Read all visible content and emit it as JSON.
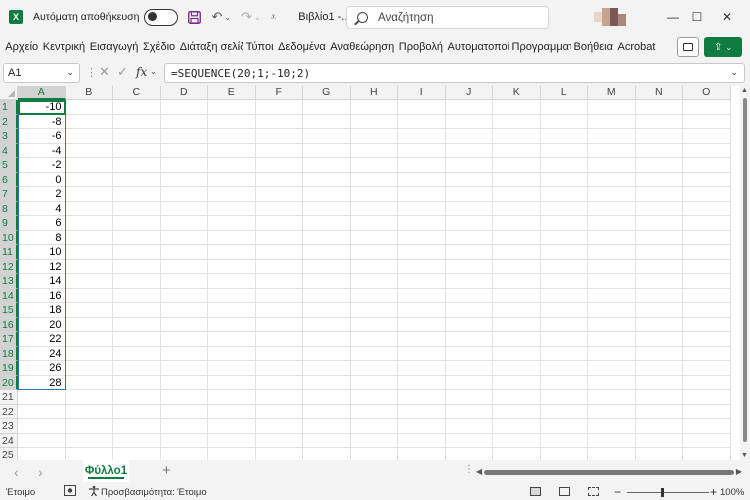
{
  "titlebar": {
    "logo_letter": "X",
    "autosave_label": "Αυτόματη αποθήκευση",
    "doc_title": "Βιβλίο1  -...",
    "search_placeholder": "Αναζήτηση",
    "minimize": "—",
    "maximize": "☐",
    "close": "✕"
  },
  "ribbon": {
    "tabs": [
      "Αρχείο",
      "Κεντρική",
      "Εισαγωγή",
      "Σχέδιο",
      "Διάταξη σελίδ",
      "Τύποι",
      "Δεδομένα",
      "Αναθεώρηση",
      "Προβολή",
      "Αυτοματοποί",
      "Προγραμματ",
      "Βοήθεια",
      "Acrobat"
    ]
  },
  "formula_bar": {
    "name_box": "A1",
    "formula": "=SEQUENCE(20;1;-10;2)"
  },
  "grid": {
    "columns": [
      "A",
      "B",
      "C",
      "D",
      "E",
      "F",
      "G",
      "H",
      "I",
      "J",
      "K",
      "L",
      "M",
      "N",
      "O"
    ],
    "rows": [
      "1",
      "2",
      "3",
      "4",
      "5",
      "6",
      "7",
      "8",
      "9",
      "10",
      "11",
      "12",
      "13",
      "14",
      "15",
      "16",
      "17",
      "18",
      "19",
      "20",
      "21",
      "22",
      "23",
      "24",
      "25"
    ],
    "column_a_values": [
      "-10",
      "-8",
      "-6",
      "-4",
      "-2",
      "0",
      "2",
      "4",
      "6",
      "8",
      "10",
      "12",
      "14",
      "16",
      "18",
      "20",
      "22",
      "24",
      "26",
      "28"
    ],
    "selected_column": "A",
    "selected_rows": 20
  },
  "sheets": {
    "tabs": [
      "Φύλλο1"
    ],
    "add": "+"
  },
  "statusbar": {
    "ready": "Έτοιμο",
    "accessibility": "Προσβασιμότητα: Έτοιμο",
    "zoom": "100%",
    "zoom_minus": "−",
    "zoom_plus": "+"
  },
  "colors": {
    "accent": "#107c41",
    "selection_border": "#2f75b5"
  }
}
